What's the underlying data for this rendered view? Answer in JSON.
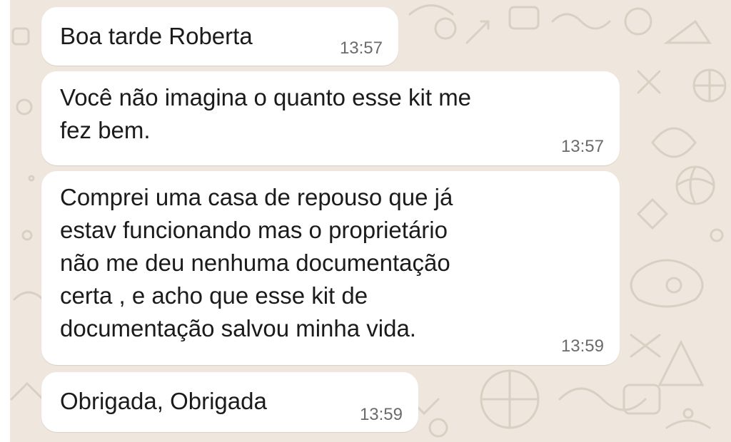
{
  "chat": {
    "background_color": "#efe7dd",
    "bubble_color": "#ffffff",
    "messages": [
      {
        "text": "Boa tarde Roberta",
        "time": "13:57"
      },
      {
        "text": "Você não imagina o quanto esse kit me\nfez bem.",
        "time": "13:57"
      },
      {
        "text": "Comprei uma casa de repouso que já\nestav funcionando  mas o proprietário\nnão me deu nenhuma documentação\ncerta , e acho que esse kit de\ndocumentação salvou minha vida.",
        "time": "13:59"
      },
      {
        "text": "Obrigada, Obrigada",
        "time": "13:59"
      }
    ]
  }
}
